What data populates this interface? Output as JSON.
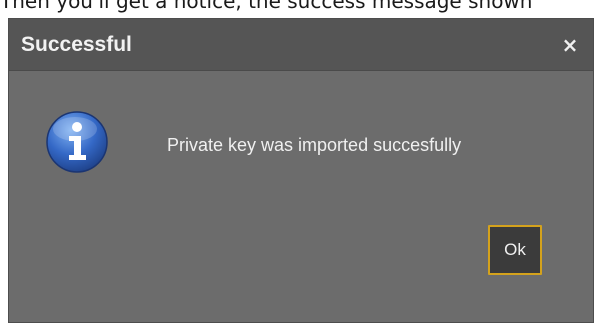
{
  "background": {
    "caption_text": "Then you'll get a notice, the success message shown"
  },
  "dialog": {
    "title": "Successful",
    "close_glyph": "×",
    "icon": "info-icon",
    "message": "Private key was imported succesfully",
    "ok_label": "Ok",
    "colors": {
      "body": "#6c6c6c",
      "titlebar": "#555555",
      "ok_border": "#d4a21c",
      "ok_fill": "#3b3b3b",
      "icon_blue": "#2f5fb4"
    }
  }
}
